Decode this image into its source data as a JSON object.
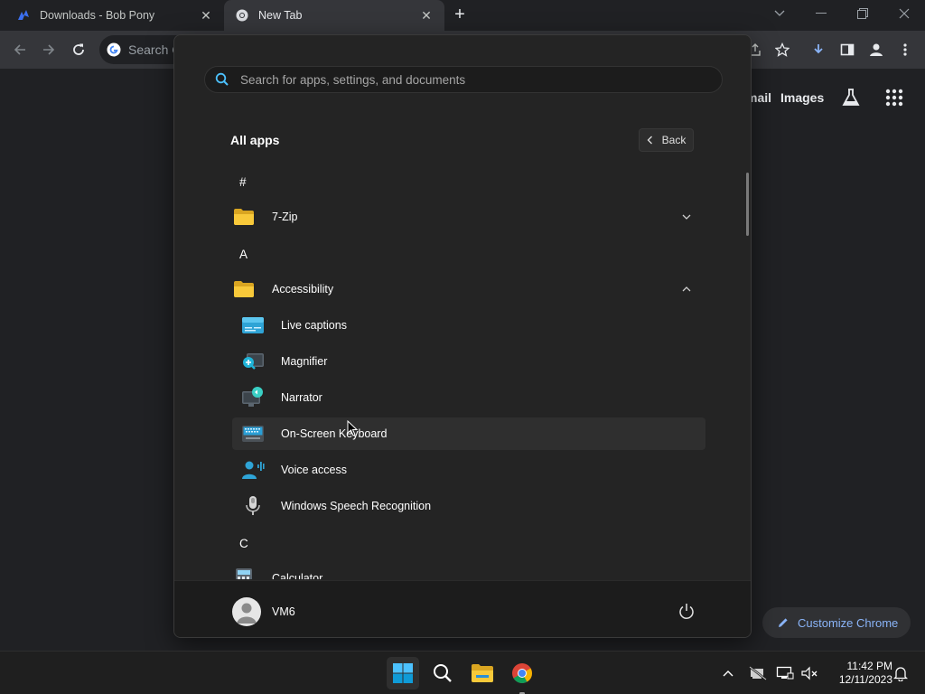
{
  "browser": {
    "tabs": [
      {
        "title": "Downloads - Bob Pony",
        "active": false
      },
      {
        "title": "New Tab",
        "active": true
      }
    ],
    "omnibox_placeholder": "Search G",
    "ntp_links": [
      "mail",
      "Images"
    ],
    "customize_label": "Customize Chrome"
  },
  "start_menu": {
    "search_placeholder": "Search for apps, settings, and documents",
    "all_apps_title": "All apps",
    "back_label": "Back",
    "sections": {
      "hash": "#",
      "a": "A",
      "c": "C"
    },
    "apps": {
      "zip": "7-Zip",
      "accessibility": "Accessibility",
      "live_captions": "Live captions",
      "magnifier": "Magnifier",
      "narrator": "Narrator",
      "osk": "On-Screen Keyboard",
      "voice_access": "Voice access",
      "speech": "Windows Speech Recognition",
      "calculator": "Calculator"
    },
    "user": "VM6"
  },
  "taskbar": {
    "time": "11:42 PM",
    "date": "12/11/2023"
  },
  "colors": {
    "accent_blue": "#8ab4f8",
    "windows_blue": "#0f9bd7",
    "folder_yellow": "#f4c430"
  }
}
